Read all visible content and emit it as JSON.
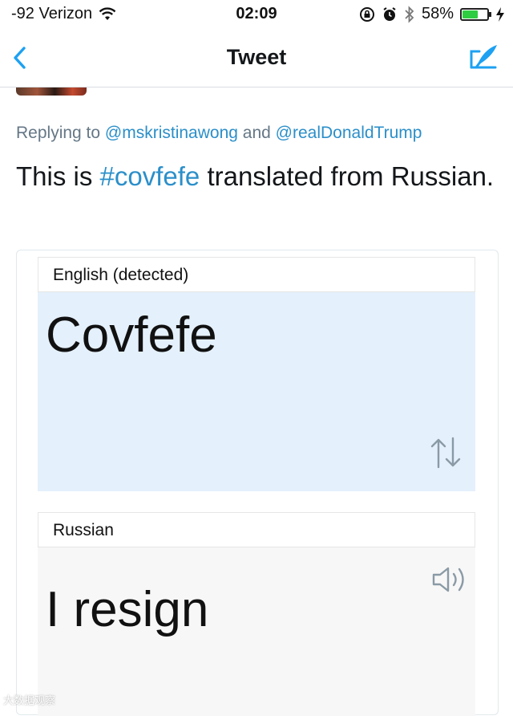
{
  "status_bar": {
    "carrier": "-92 Verizon",
    "time": "02:09",
    "battery_percent": "58%",
    "battery_level": 0.58,
    "icons": [
      "wifi-icon",
      "rotation-lock-icon",
      "alarm-icon",
      "bluetooth-icon",
      "battery-icon",
      "charging-icon"
    ]
  },
  "nav": {
    "title": "Tweet",
    "back_icon": "chevron-left-icon",
    "compose_icon": "compose-tweet-icon"
  },
  "reply": {
    "prefix": "Replying to",
    "mention_1": "@mskristinawong",
    "conjunction": "and",
    "mention_2": "@realDonaldTrump"
  },
  "tweet": {
    "text_before": "This is",
    "hashtag": "#covfefe",
    "text_after": "translated from Russian."
  },
  "translation": {
    "source_language": "English (detected)",
    "source_text": "Covfefe",
    "target_language": "Russian",
    "target_text": "I resign",
    "swap_icon": "swap-languages-icon",
    "speaker_icon": "speaker-icon"
  },
  "watermark": {
    "text": "大数据观察"
  },
  "colors": {
    "link": "#2b8fc9",
    "source_panel": "#e4f0fb",
    "target_panel": "#f7f7f7",
    "battery_green": "#2ecc40"
  }
}
